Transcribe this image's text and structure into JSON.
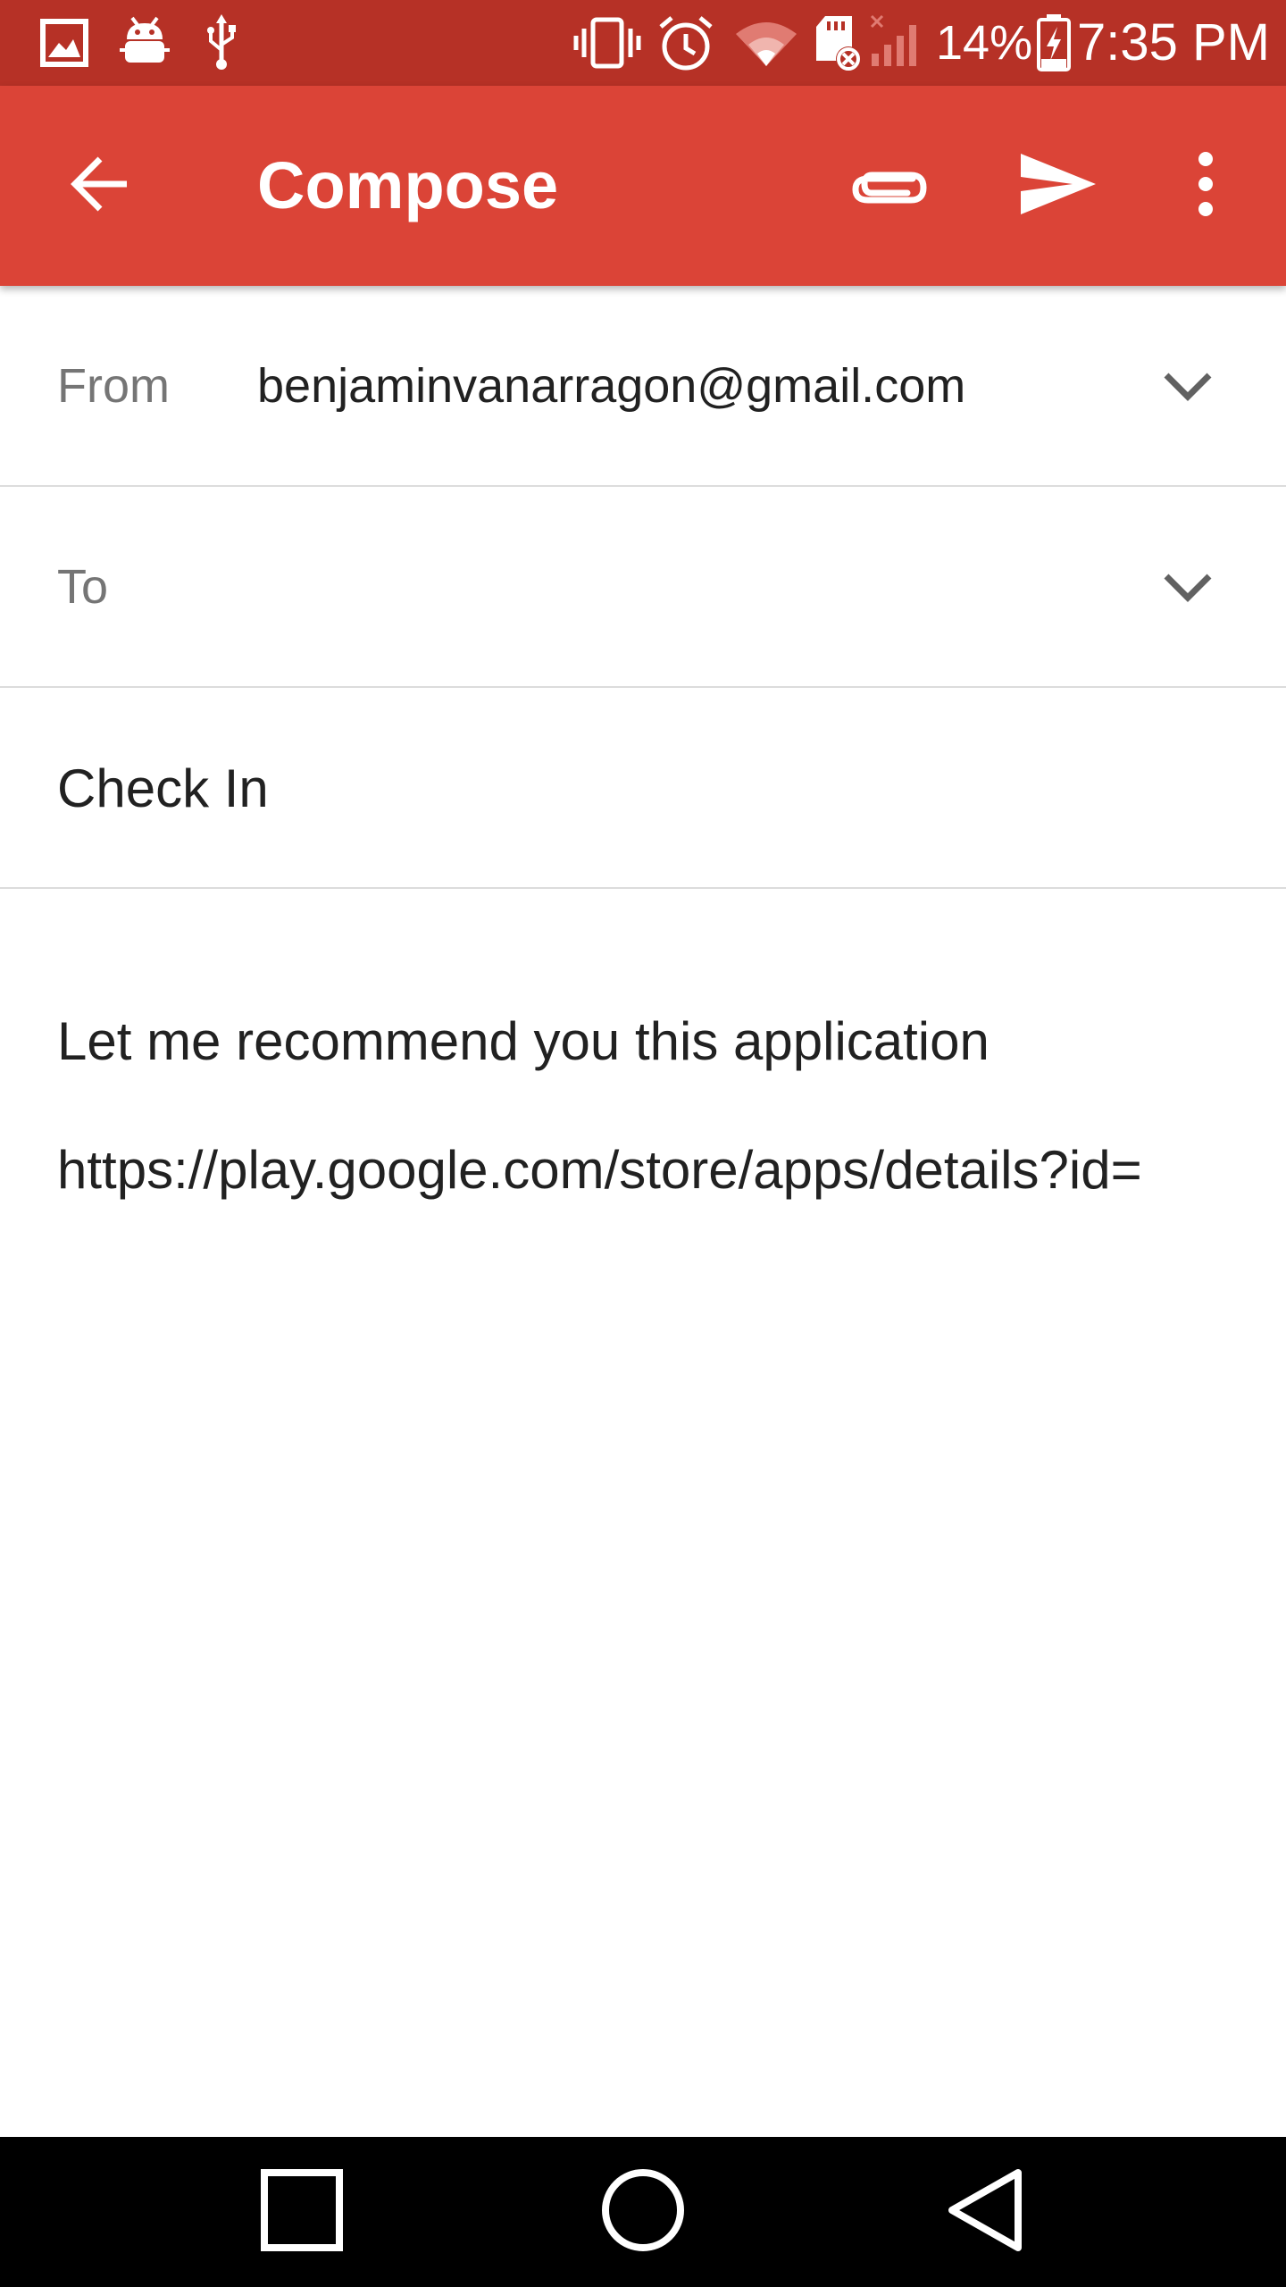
{
  "status_bar": {
    "icons": [
      "gallery-icon",
      "android-debug-icon",
      "usb-icon",
      "vibrate-icon",
      "alarm-icon",
      "wifi-icon",
      "sd-card-error-icon",
      "signal-icon",
      "battery-charging-icon"
    ],
    "battery_percent": "14%",
    "time": "7:35 PM"
  },
  "app_bar": {
    "title": "Compose",
    "actions": [
      "back-icon",
      "attach-icon",
      "send-icon",
      "more-vert-icon"
    ],
    "color": "#db4437"
  },
  "from": {
    "label": "From",
    "value": "benjaminvanarragon@gmail.com"
  },
  "to": {
    "label": "To",
    "value": ""
  },
  "subject": {
    "value": "Check In"
  },
  "body": {
    "line1": "Let me recommend you this application",
    "line2": "https://play.google.com/store/apps/details?id="
  },
  "nav_bar": {
    "buttons": [
      "recents-icon",
      "home-icon",
      "back-nav-icon"
    ]
  }
}
